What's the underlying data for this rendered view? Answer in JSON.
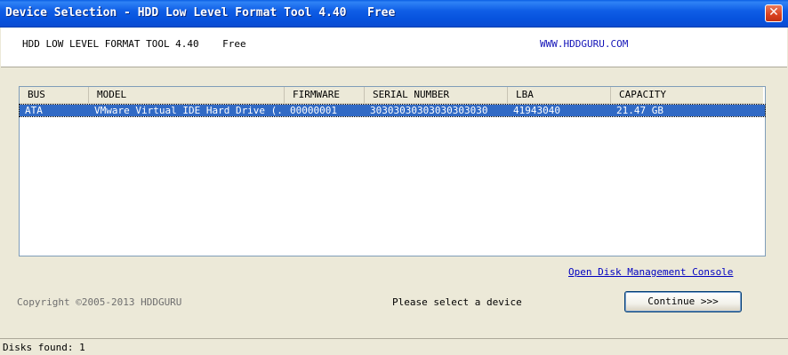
{
  "window": {
    "title": "Device Selection - HDD Low Level Format Tool 4.40   Free",
    "close_glyph": "✕"
  },
  "header": {
    "app_name": "HDD LOW LEVEL FORMAT TOOL 4.40    Free",
    "site": "WWW.HDDGURU.COM"
  },
  "device_list": {
    "columns": [
      "BUS",
      "MODEL",
      "FIRMWARE",
      "SERIAL NUMBER",
      "LBA",
      "CAPACITY"
    ],
    "rows": [
      {
        "bus": "ATA",
        "model": "VMware Virtual IDE Hard Drive (...",
        "firmware": "00000001",
        "serial": "30303030303030303030",
        "lba": "41943040",
        "capacity": "21.47 GB",
        "selected": true
      }
    ]
  },
  "links": {
    "disk_management": "Open Disk Management Console"
  },
  "footer": {
    "copyright": "Copyright ©2005-2013 HDDGURU",
    "status": "Please select a device",
    "continue_label": "Continue >>>"
  },
  "statusbar": {
    "disks_found": "Disks found: 1"
  },
  "colors": {
    "titlebar": "#0a5fe3",
    "selection": "#316ac5",
    "link": "#0000c0"
  }
}
